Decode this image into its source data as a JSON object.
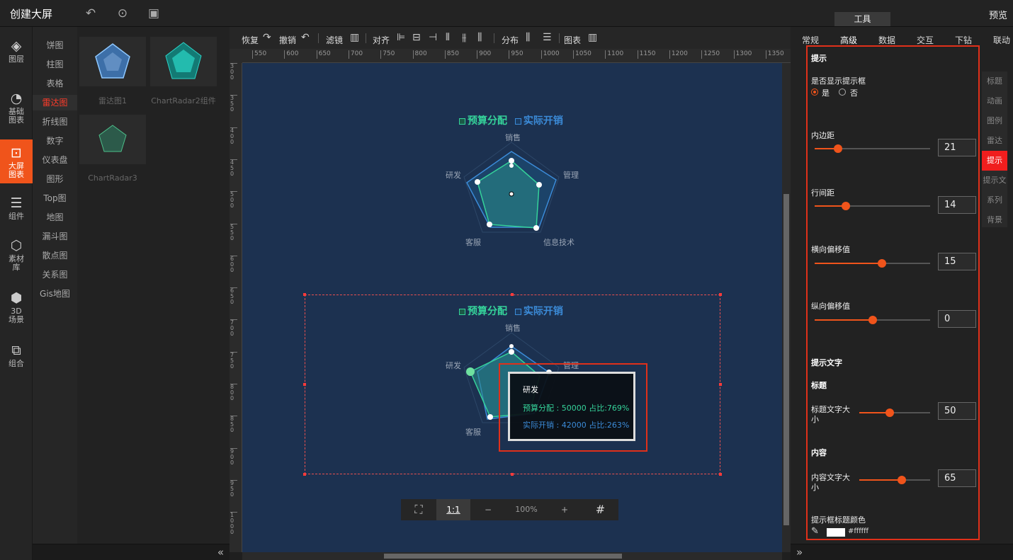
{
  "app": {
    "title": "创建大屏",
    "preview": "预览",
    "tools_tab": "工具"
  },
  "leftnav": [
    {
      "icon": "layers-icon",
      "glyph": "◈",
      "label": "图层"
    },
    {
      "icon": "clock-chart-icon",
      "glyph": "◔",
      "label": "基础图表"
    },
    {
      "icon": "screen-chart-icon",
      "glyph": "⊡",
      "label": "大屏图表"
    },
    {
      "icon": "sliders-icon",
      "glyph": "☰",
      "label": "组件"
    },
    {
      "icon": "hexagons-icon",
      "glyph": "⬡",
      "label": "素材库"
    },
    {
      "icon": "cube-icon",
      "glyph": "⬢",
      "label": "3D场景"
    },
    {
      "icon": "group-icon",
      "glyph": "⧉",
      "label": "组合"
    }
  ],
  "categories": [
    "饼图",
    "柱图",
    "表格",
    "雷达图",
    "折线图",
    "数字",
    "仪表盘",
    "图形",
    "Top图",
    "地图",
    "漏斗图",
    "散点图",
    "关系图",
    "Gis地图"
  ],
  "active_category": "雷达图",
  "thumbnails": [
    "雷达图1",
    "ChartRadar2组件",
    "ChartRadar3"
  ],
  "toolbar": {
    "redo": "恢复",
    "undo": "撤销",
    "filter": "滤镜",
    "align": "对齐",
    "distribute": "分布",
    "chart": "图表"
  },
  "ruler_h": [
    "550",
    "600",
    "650",
    "700",
    "750",
    "800",
    "850",
    "900",
    "950",
    "1000",
    "1050",
    "1100",
    "1150",
    "1200",
    "1250",
    "1300",
    "1350"
  ],
  "ruler_v": [
    "300",
    "350",
    "400",
    "450",
    "500",
    "550",
    "600",
    "650",
    "700",
    "750",
    "800",
    "850",
    "900",
    "950",
    "1000"
  ],
  "chart_data": [
    {
      "type": "radar",
      "indicators": [
        "销售",
        "管理",
        "信息技术",
        "客服",
        "研发"
      ],
      "legend": [
        "预算分配",
        "实际开销"
      ],
      "colors": [
        "#35d39a",
        "#3b8bd8"
      ]
    },
    {
      "type": "radar",
      "indicators": [
        "销售",
        "管理",
        "信息技术",
        "客服",
        "研发"
      ],
      "legend": [
        "预算分配",
        "实际开销"
      ],
      "colors": [
        "#35d39a",
        "#3b8bd8"
      ],
      "tooltip": {
        "title": "研发",
        "lines": [
          "预算分配 : 50000 占比:769%",
          "实际开销 : 42000 占比:263%"
        ]
      }
    }
  ],
  "zoom": {
    "ratio": "1:1",
    "minus": "−",
    "value": "100%",
    "plus": "+"
  },
  "right_tabs": [
    "常规",
    "高级",
    "数据",
    "交互",
    "下钻",
    "联动"
  ],
  "active_right_tab": "高级",
  "settings": {
    "section": "提示",
    "show_tooltip": "是否显示提示框",
    "yes": "是",
    "no": "否",
    "padding": {
      "label": "内边距",
      "value": "21",
      "level": 0.2
    },
    "line_spacing": {
      "label": "行间距",
      "value": "14",
      "level": 0.27
    },
    "h_offset": {
      "label": "横向偏移值",
      "value": "15",
      "level": 0.58
    },
    "v_offset": {
      "label": "纵向偏移值",
      "value": "0",
      "level": 0.5
    },
    "tip_text": "提示文字",
    "title_section": "标题",
    "title_size": {
      "label": "标题文字大小",
      "value": "50",
      "level": 0.43
    },
    "content_section": "内容",
    "content_size": {
      "label": "内容文字大小",
      "value": "65",
      "level": 0.6
    },
    "title_color_label": "提示框标题颜色",
    "title_color": "#ffffff"
  },
  "side_tabs": [
    "标题",
    "动画",
    "图例",
    "雷达",
    "提示",
    "提示文",
    "系列",
    "背景"
  ],
  "active_side_tab": "提示"
}
